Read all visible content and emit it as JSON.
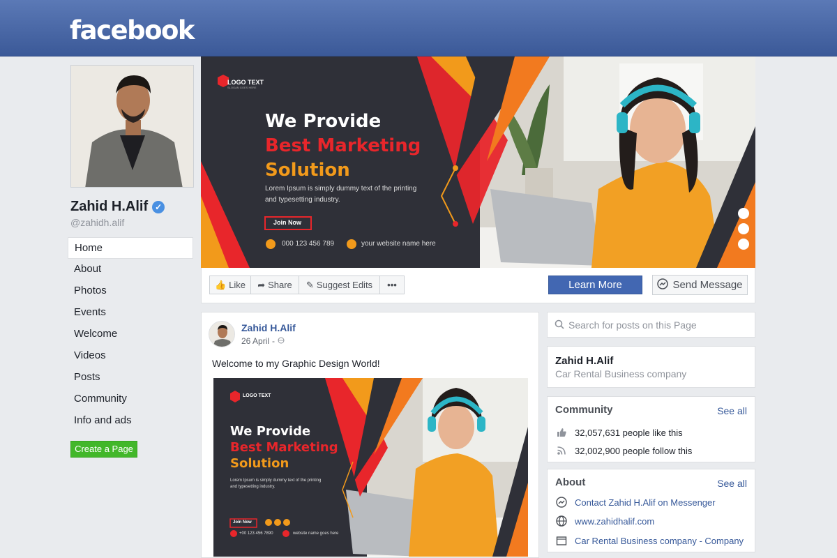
{
  "header": {
    "brand": "facebook"
  },
  "profile": {
    "name": "Zahid H.Alif",
    "handle": "@zahidh.alif",
    "verified_mark": "✓"
  },
  "nav": {
    "items": [
      {
        "label": "Home",
        "active": true
      },
      {
        "label": "About"
      },
      {
        "label": "Photos"
      },
      {
        "label": "Events"
      },
      {
        "label": "Welcome"
      },
      {
        "label": "Videos"
      },
      {
        "label": "Posts"
      },
      {
        "label": "Community"
      },
      {
        "label": "Info and ads"
      }
    ],
    "create_page": "Create a Page"
  },
  "cover": {
    "logo_text": "LOGO TEXT",
    "logo_slogan": "SLOGAN GOES HERE",
    "headline_1": "We Provide",
    "headline_2": "Best Marketing",
    "headline_3": "Solution",
    "body": "Lorem Ipsum is simply dummy text of the printing",
    "body_2": "and typesetting industry.",
    "cta": "Join Now",
    "phone": "000 123 456 789",
    "website": "your website name here",
    "colors": {
      "dark": "#2f3038",
      "red": "#e8262b",
      "orange": "#f29a1b",
      "shirt": "#f2a024"
    }
  },
  "actions": {
    "like": "Like",
    "share": "Share",
    "suggest": "Suggest Edits",
    "more": "•••",
    "learn_more": "Learn More",
    "send_message": "Send Message"
  },
  "post": {
    "author": "Zahid H.Alif",
    "date": "26 April",
    "separator": "-",
    "text": "Welcome to my Graphic Design World!",
    "image": {
      "logo_text": "LOGO TEXT",
      "headline_1": "We Provide",
      "headline_2": "Best Marketing",
      "headline_3": "Solution",
      "body": "Lorem Ipsum is simply dummy text of the printing",
      "body_2": "and typesetting industry.",
      "cta": "Join Now",
      "phone": "+00 123 456 7890",
      "website": "website name goes here"
    }
  },
  "sidebar": {
    "search_placeholder": "Search for posts on this Page",
    "page_name": "Zahid H.Alif",
    "category": "Car Rental Business company",
    "community": {
      "title": "Community",
      "see_all": "See all",
      "likes": "32,057,631 people like this",
      "follows": "32,002,900 people follow this"
    },
    "about": {
      "title": "About",
      "see_all": "See all",
      "messenger": "Contact Zahid H.Alif on Messenger",
      "website": "www.zahidhalif.com",
      "category": "Car Rental Business company - Company"
    }
  },
  "colors": {
    "fb_blue": "#3b5998",
    "link": "#365899",
    "green": "#42b72a",
    "bg": "#e9ebee"
  }
}
